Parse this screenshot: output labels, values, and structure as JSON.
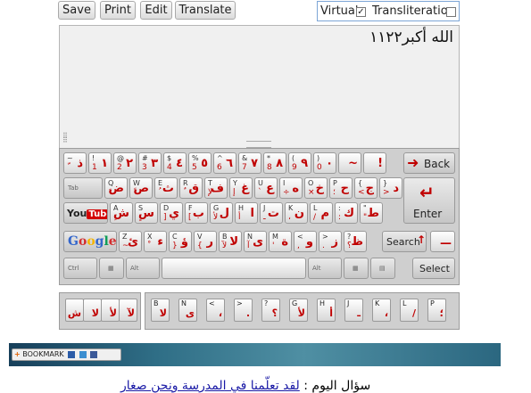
{
  "toolbar": {
    "save": "Save",
    "print": "Print",
    "edit": "Edit",
    "translate": "Translate"
  },
  "options": {
    "virtual_label": "Virtual",
    "virtual_checked": true,
    "translit_label": "Transliteration",
    "translit_checked": false
  },
  "editor": {
    "text": "الله أكبر١١٢٢"
  },
  "keyboard": {
    "row1": [
      {
        "l": "~",
        "m": "ذ",
        "s": "ّ"
      },
      {
        "l": "!",
        "m": "١",
        "s": "1"
      },
      {
        "l": "@",
        "m": "٢",
        "s": "2"
      },
      {
        "l": "#",
        "m": "٣",
        "s": "3"
      },
      {
        "l": "$",
        "m": "٤",
        "s": "4"
      },
      {
        "l": "%",
        "m": "٥",
        "s": "5"
      },
      {
        "l": "^",
        "m": "٦",
        "s": "6"
      },
      {
        "l": "&",
        "m": "٧",
        "s": "7"
      },
      {
        "l": "*",
        "m": "٨",
        "s": "8"
      },
      {
        "l": "(",
        "m": "٩",
        "s": "9"
      },
      {
        "l": ")",
        "m": "٠",
        "s": "0"
      },
      {
        "l": "",
        "m": "~",
        "s": ""
      },
      {
        "l": "",
        "m": "!",
        "s": ""
      }
    ],
    "backspace": "Back",
    "tab": "Tab",
    "row2": [
      {
        "l": "Q",
        "m": "ض",
        "s": "َ"
      },
      {
        "l": "W",
        "m": "ص",
        "s": "ً"
      },
      {
        "l": "E",
        "m": "ث",
        "s": "ُ"
      },
      {
        "l": "R",
        "m": "ق",
        "s": "ٌ"
      },
      {
        "l": "T",
        "m": "ف",
        "s": "ﻹ"
      },
      {
        "l": "Y",
        "m": "غ",
        "s": "إ"
      },
      {
        "l": "U",
        "m": "ع",
        "s": "`"
      },
      {
        "l": "I",
        "m": "ه",
        "s": "÷"
      },
      {
        "l": "O",
        "m": "خ",
        "s": "×"
      },
      {
        "l": "P",
        "m": "ح",
        "s": "؛"
      },
      {
        "l": "{",
        "m": "ج",
        "s": "<"
      },
      {
        "l": "}",
        "m": "د",
        "s": ">"
      }
    ],
    "youtube": {
      "you": "You",
      "tube": "Tube"
    },
    "row3": [
      {
        "l": "A",
        "m": "ش",
        "s": "ِ"
      },
      {
        "l": "S",
        "m": "س",
        "s": "ٍ"
      },
      {
        "l": "D",
        "m": "ي",
        "s": "]"
      },
      {
        "l": "F",
        "m": "ب",
        "s": "["
      },
      {
        "l": "G",
        "m": "ل",
        "s": "ﻷ"
      },
      {
        "l": "H",
        "m": "ا",
        "s": "أ"
      },
      {
        "l": "J",
        "m": "ت",
        "s": "ـ"
      },
      {
        "l": "K",
        "m": "ن",
        "s": "،"
      },
      {
        "l": "L",
        "m": "م",
        "s": "/"
      },
      {
        "l": ":",
        "m": "ك",
        "s": ":"
      },
      {
        "l": "\"",
        "m": "ط",
        "s": "\""
      }
    ],
    "enter": "Enter",
    "google": "Google",
    "row4": [
      {
        "l": "Z",
        "m": "ئ",
        "s": "~"
      },
      {
        "l": "X",
        "m": "ء",
        "s": "ْ"
      },
      {
        "l": "C",
        "m": "ؤ",
        "s": "}"
      },
      {
        "l": "V",
        "m": "ر",
        "s": "{"
      },
      {
        "l": "B",
        "m": "لا",
        "s": "ﻵ"
      },
      {
        "l": "N",
        "m": "ى",
        "s": "آ"
      },
      {
        "l": "M",
        "m": "ة",
        "s": "'"
      },
      {
        "l": "<",
        "m": "و",
        "s": ","
      },
      {
        "l": ">",
        "m": "ز",
        "s": "."
      },
      {
        "l": "?",
        "m": "ظ",
        "s": "؟"
      }
    ],
    "search": "Search",
    "row4_last": {
      "l": "",
      "m": "",
      "s": ""
    },
    "bottom": {
      "ctrl": "Ctrl",
      "alt": "Alt",
      "alt_gr": "Alt",
      "select": "Select"
    }
  },
  "panel_left": [
    {
      "l": "",
      "m": "ش"
    },
    {
      "l": "",
      "m": "ﻻ"
    },
    {
      "l": "",
      "m": "ﻷ"
    },
    {
      "l": "",
      "m": "ﻵ"
    }
  ],
  "panel_right": [
    {
      "l": "B",
      "m": "ﻻ"
    },
    {
      "l": "N",
      "m": "ى"
    },
    {
      "l": "<",
      "m": "،"
    },
    {
      "l": ">",
      "m": "."
    },
    {
      "l": "?",
      "m": "؟"
    },
    {
      "l": "G",
      "m": "ﻷ"
    },
    {
      "l": "H",
      "m": "أ"
    },
    {
      "l": "J",
      "m": "ـ"
    },
    {
      "l": "K",
      "m": "،"
    },
    {
      "l": "L",
      "m": "/"
    },
    {
      "l": "P",
      "m": "؛"
    }
  ],
  "bookmark": {
    "label": "BOOKMARK"
  },
  "question": {
    "prefix": "سؤال اليوم :",
    "link": "لقد تعلّمنا في المدرسة ونحن صغار"
  },
  "colors": {
    "accent_red": "#c00000",
    "strip": "#2f6e86",
    "link": "#1a1aa6"
  }
}
